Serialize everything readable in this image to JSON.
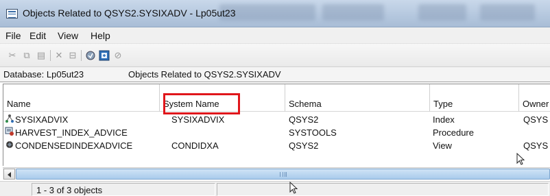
{
  "window": {
    "title": "Objects Related to QSYS2.SYSIXADV - Lp05ut23"
  },
  "menu": [
    "File",
    "Edit",
    "View",
    "Help"
  ],
  "toolbar_icons": [
    "cut-icon",
    "copy-icon",
    "paste-icon",
    "delete-icon",
    "properties-icon",
    "run-icon",
    "refresh-icon",
    "stop-icon"
  ],
  "infobar": {
    "database": "Database: Lp05ut23",
    "context": "Objects Related to QSYS2.SYSIXADV"
  },
  "table": {
    "columns": [
      "Name",
      "System Name",
      "Schema",
      "Type",
      "Owner"
    ],
    "rows": [
      {
        "name": "SYSIXADVIX",
        "system_name": "SYSIXADVIX",
        "schema": "QSYS2",
        "type": "Index",
        "owner": "QSYS",
        "icon": "index-icon"
      },
      {
        "name": "HARVEST_INDEX_ADVICE",
        "system_name": "",
        "schema": "SYSTOOLS",
        "type": "Procedure",
        "owner": "",
        "icon": "procedure-icon"
      },
      {
        "name": "CONDENSEDINDEXADVICE",
        "system_name": "CONDIDXA",
        "schema": "QSYS2",
        "type": "View",
        "owner": "QSYS",
        "icon": "view-icon"
      }
    ]
  },
  "status": {
    "count": "1 - 3 of 3 objects"
  },
  "colors": {
    "highlight": "#e0161b",
    "titlebar": "#b4c7de",
    "scroll_thumb": "#a9cbec"
  }
}
